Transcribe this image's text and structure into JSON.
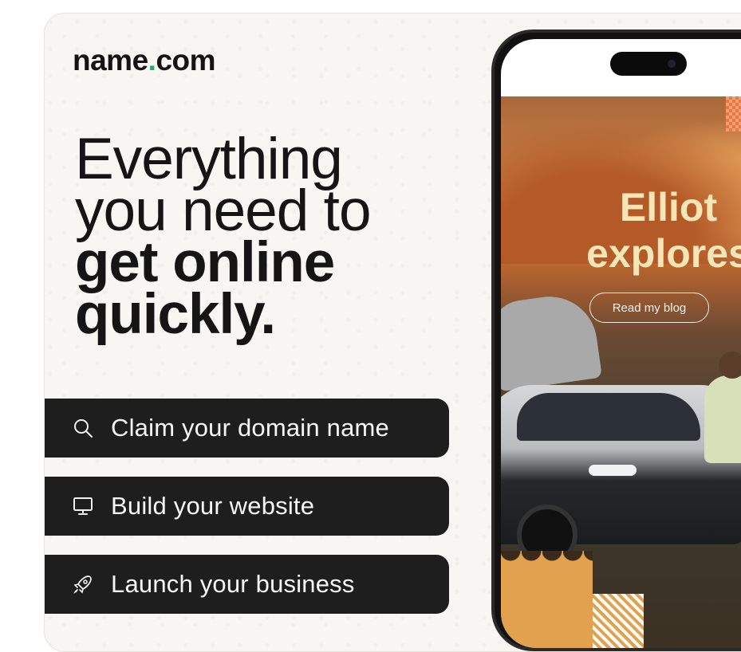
{
  "brand": {
    "logo_left": "name",
    "logo_dot": ".",
    "logo_right": "com",
    "accent": "#25a86b"
  },
  "headline": {
    "line1": "Everything",
    "line2": "you need to",
    "line3": "get online",
    "line4": "quickly."
  },
  "actions": [
    {
      "label": "Claim your domain name",
      "icon": "search-icon"
    },
    {
      "label": "Build your website",
      "icon": "monitor-icon"
    },
    {
      "label": "Launch your business",
      "icon": "rocket-icon"
    }
  ],
  "phone": {
    "title_line1": "Elliot",
    "title_line2": "explores",
    "cta": "Read my blog"
  },
  "colors": {
    "pill_bg": "#1e1e1e",
    "text_dark": "#151515",
    "hero_title": "#f6e6b6"
  }
}
